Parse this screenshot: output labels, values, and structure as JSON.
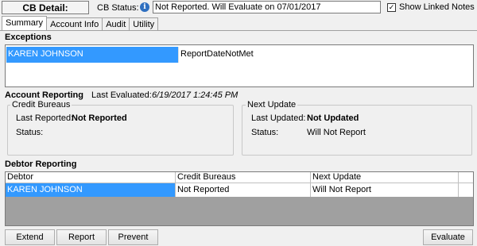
{
  "header": {
    "title": "CB Detail:",
    "status_label": "CB Status:",
    "status_value": "Not Reported. Will Evaluate on 07/01/2017",
    "show_linked_notes": "Show Linked Notes"
  },
  "tabs": [
    {
      "label": "Summary"
    },
    {
      "label": "Account Info"
    },
    {
      "label": "Audit"
    },
    {
      "label": "Utility"
    }
  ],
  "exceptions": {
    "title": "Exceptions",
    "rows": [
      {
        "name": "KAREN JOHNSON",
        "exception": "ReportDateNotMet"
      }
    ]
  },
  "account_reporting": {
    "title": "Account Reporting",
    "last_evaluated_label": "Last Evaluated:",
    "last_evaluated_value": "6/19/2017 1:24:45 PM",
    "credit_bureaus": {
      "legend": "Credit Bureaus",
      "last_reported_label": "Last Reported:",
      "last_reported_value": "Not Reported",
      "status_label": "Status:",
      "status_value": ""
    },
    "next_update": {
      "legend": "Next Update",
      "last_updated_label": "Last Updated:",
      "last_updated_value": "Not Updated",
      "status_label": "Status:",
      "status_value": "Will Not Report"
    }
  },
  "debtor_reporting": {
    "title": "Debtor Reporting",
    "columns": [
      "Debtor",
      "Credit Bureaus",
      "Next Update"
    ],
    "rows": [
      {
        "debtor": "KAREN JOHNSON",
        "credit_bureaus": "Not Reported",
        "next_update": "Will Not Report"
      }
    ]
  },
  "buttons": {
    "extend": "Extend",
    "report": "Report",
    "prevent": "Prevent",
    "evaluate": "Evaluate"
  },
  "colors": {
    "selection": "#3399ff",
    "window_bg": "#f0f0f0",
    "grid_empty_bg": "#a0a0a0",
    "info_icon": "#2e6fc0"
  }
}
